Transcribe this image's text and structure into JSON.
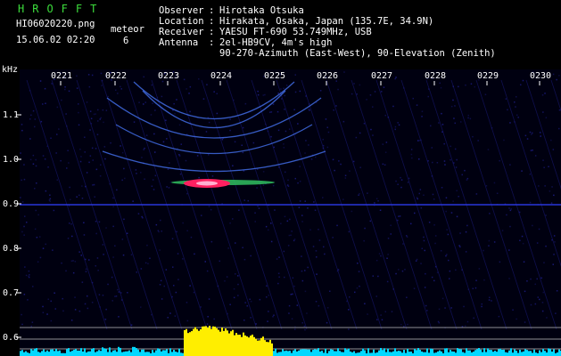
{
  "header": {
    "app_name": "HROFFT",
    "filename": "HI06020220.png",
    "datetime": "15.06.02 02:20",
    "meteor_label": "meteor",
    "meteor_count": "6",
    "observer_label": "Observer",
    "observer": "Hirotaka Otsuka",
    "location_label": "Location",
    "location": "Hirakata, Osaka, Japan (135.7E, 34.9N)",
    "receiver_label": "Receiver",
    "receiver": "YAESU FT-690 53.749MHz, USB",
    "antenna_label": "Antenna",
    "antenna_line1": "2el-HB9CV, 4m's high",
    "antenna_line2": "90-270-Azimuth (East-West), 90-Elevation (Zenith)"
  },
  "spectrogram": {
    "y_unit": "kHz",
    "y_ticks": [
      "1.1",
      "1.0",
      "0.9",
      "0.8",
      "0.7",
      "0.6"
    ],
    "x_ticks": [
      "0221",
      "0222",
      "0223",
      "0224",
      "0225",
      "0226",
      "0227",
      "0228",
      "0229",
      "0230"
    ],
    "colors": {
      "background": "#000010",
      "noise": "#1a1a7a",
      "trail": "#4a7aff",
      "echo_core": "#ff2060",
      "reference_line": "#3040ff",
      "histogram": "#00d8ff",
      "histogram_peak": "#ffee00"
    }
  }
}
